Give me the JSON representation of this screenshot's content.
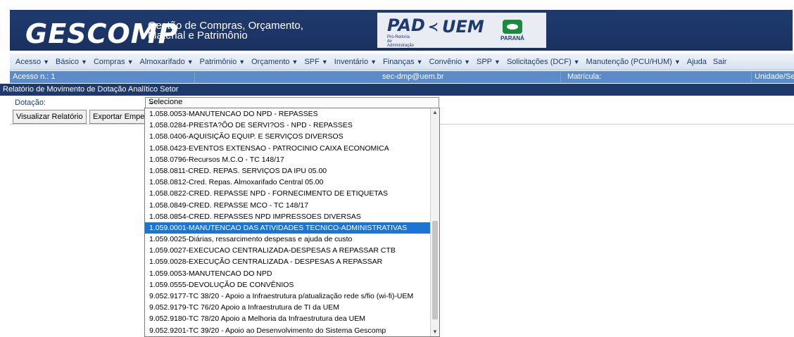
{
  "app": {
    "name": "GESCOMP",
    "tagline_line1": "Gestão de Compras, Orçamento,",
    "tagline_line2": "Material e Patrimônio",
    "partner_pad": "PAD",
    "partner_pad_sub": "Pró-Reitoria de Administração",
    "partner_uem": "UEM",
    "partner_parana": "PARANÁ"
  },
  "menu": [
    {
      "label": "Acesso",
      "arrow": "▼"
    },
    {
      "label": "Básico",
      "arrow": "▼"
    },
    {
      "label": "Compras",
      "arrow": "▼"
    },
    {
      "label": "Almoxarifado",
      "arrow": "▼"
    },
    {
      "label": "Patrimônio",
      "arrow": "▼"
    },
    {
      "label": "Orçamento",
      "arrow": "▼"
    },
    {
      "label": "SPF",
      "arrow": "▼"
    },
    {
      "label": "Inventário",
      "arrow": "▼"
    },
    {
      "label": "Finanças",
      "arrow": "▼"
    },
    {
      "label": "Convênio",
      "arrow": "▼"
    },
    {
      "label": "SPP",
      "arrow": "▼"
    },
    {
      "label": "Solicitações (DCF)",
      "arrow": "▼"
    },
    {
      "label": "Manutenção (PCU/HUM)",
      "arrow": "▼"
    },
    {
      "label": "Ajuda",
      "arrow": ""
    },
    {
      "label": "Sair",
      "arrow": ""
    }
  ],
  "info": {
    "acesso": "Acesso n.: 1",
    "email": "sec-dmp@uem.br",
    "matricula": "Matrícula:",
    "unidade": "Unidade/Se"
  },
  "page": {
    "title": "Relatório de Movimento de Dotação Analítico Setor",
    "dotacao_label": "Dotação:",
    "select_value": "Selecione",
    "select_chevron": "⌄",
    "btn_visualizar": "Visualizar Relatório",
    "btn_exportar": "Exportar Emper"
  },
  "dropdown": {
    "selected_index": 11,
    "options": [
      "1.058.0053-MANUTENCAO DO NPD - REPASSES",
      "1.058.0284-PRESTA?ÕO DE SERVI?OS - NPD - REPASSES",
      "1.058.0406-AQUISIÇÃO EQUIP. E SERVIÇOS DIVERSOS",
      "1.058.0423-EVENTOS EXTENSAO - PATROCINIO CAIXA ECONOMICA",
      "1.058.0796-Recursos M.C.O - TC 148/17",
      "1.058.0811-CRED. REPAS. SERVIÇOS DA IPU 05.00",
      "1.058.0812-Cred. Repas. Almoxarifado Central 05.00",
      "1.058.0822-CRED. REPASSE NPD - FORNECIMENTO DE ETIQUETAS",
      "1.058.0849-CRED. REPASSE MCO - TC 148/17",
      "1.058.0854-CRED. REPASSES NPD IMPRESSOES DIVERSAS",
      "1.059.0001-MANUTENCAO DAS ATIVIDADES TECNICO-ADMINISTRATIVAS",
      "1.059.0025-Diárias, ressarcimento despesas e ajuda de custo",
      "1.059.0027-EXECUCAO CENTRALIZADA-DESPESAS A REPASSAR CTB",
      "1.059.0028-EXECUÇÃO CENTRALIZADA - DESPESAS A REPASSAR",
      "1.059.0053-MANUTENCAO DO NPD",
      "1.059.0555-DEVOLUÇÃO DE CONVÊNIOS",
      "9.052.9177-TC 38/20 - Apoio a Infraestrutura p/atualização rede s/fio (wi-fi)-UEM",
      "9.052.9179-TC 76/20 Apoio a Infraestrutura de TI da UEM",
      "9.052.9180-TC 78/20 Apoio a Melhoria da Infraestrutura dea UEM",
      "9.052.9201-TC 39/20 - Apoio ao Desenvolvimento do Sistema Gescomp"
    ],
    "highlight": 10
  },
  "colors": {
    "header_blue": "#1f3b6e",
    "info_bar": "#5b8cc9",
    "title_bar": "#1e3a6b",
    "selection": "#1e74d3"
  }
}
